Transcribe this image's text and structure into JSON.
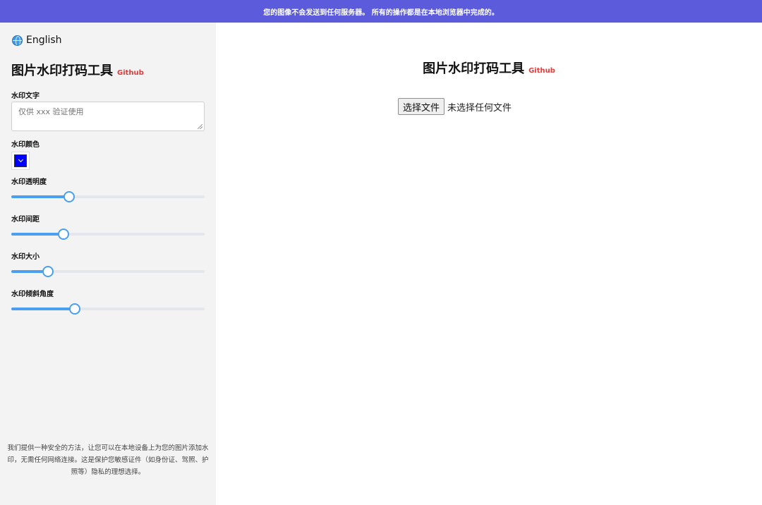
{
  "banner": {
    "text": "您的图像不会发送到任何服务器。 所有的操作都是在本地浏览器中完成的。"
  },
  "sidebar": {
    "language": "English",
    "title": "图片水印打码工具",
    "github_label": "Github",
    "watermark_text": {
      "label": "水印文字",
      "placeholder": "仅供 xxx 验证使用",
      "value": ""
    },
    "watermark_color": {
      "label": "水印颜色",
      "value": "#0000ff"
    },
    "sliders": [
      {
        "label": "水印透明度",
        "fraction": 0.3
      },
      {
        "label": "水印间距",
        "fraction": 0.27
      },
      {
        "label": "水印大小",
        "fraction": 0.19
      },
      {
        "label": "水印倾斜角度",
        "fraction": 0.33
      }
    ],
    "footnote": "我们提供一种安全的方法，让您可以在本地设备上为您的图片添加水印，无需任何网络连接。这是保护您敏感证件（如身份证、驾照、护照等）隐私的理想选择。"
  },
  "main": {
    "title": "图片水印打码工具",
    "github_label": "Github",
    "file_button": "选择文件",
    "file_status": "未选择任何文件"
  },
  "colors": {
    "banner": "#5b5bdc",
    "accent": "#4a9ff0",
    "github": "#e23b3b",
    "sidebar_bg": "#f3f3f3"
  }
}
